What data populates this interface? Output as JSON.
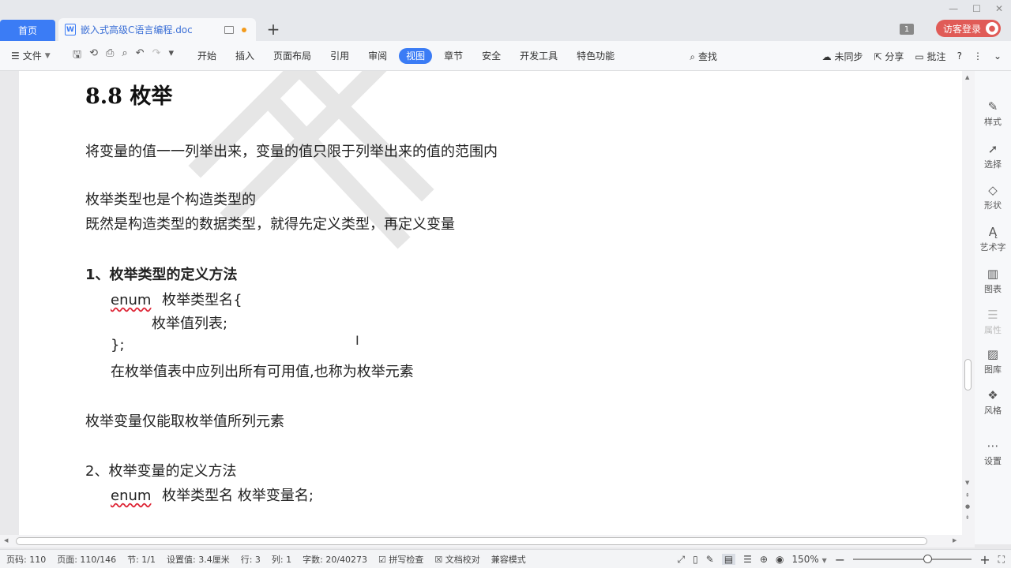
{
  "tabs": {
    "home": "首页",
    "doc_title": "嵌入式高级C语言编程.doc",
    "add": "+"
  },
  "window": {
    "minimize": "—",
    "maximize": "☐",
    "close": "✕",
    "badge": "1",
    "login": "访客登录"
  },
  "ribbon": {
    "file": "文件",
    "menu": [
      {
        "label": "开始",
        "active": false
      },
      {
        "label": "插入",
        "active": false
      },
      {
        "label": "页面布局",
        "active": false
      },
      {
        "label": "引用",
        "active": false
      },
      {
        "label": "审阅",
        "active": false
      },
      {
        "label": "视图",
        "active": true
      },
      {
        "label": "章节",
        "active": false
      },
      {
        "label": "安全",
        "active": false
      },
      {
        "label": "开发工具",
        "active": false
      },
      {
        "label": "特色功能",
        "active": false
      }
    ],
    "search": "查找",
    "sync": "未同步",
    "share": "分享",
    "comment": "批注",
    "help": "?"
  },
  "document": {
    "heading": "8.8  枚举",
    "lines": [
      "将变量的值一一列举出来，变量的值只限于列举出来的值的范围内",
      "枚举类型也是个构造类型的",
      "既然是构造类型的数据类型，就得先定义类型，再定义变量",
      "1、枚举类型的定义方法",
      "enum",
      "枚举类型名{",
      "枚举值列表;",
      "};",
      "在枚举值表中应列出所有可用值,也称为枚举元素",
      "枚举变量仅能取枚举值所列元素",
      "2、枚举变量的定义方法",
      "enum",
      "枚举类型名    枚举变量名;"
    ]
  },
  "sidepanel": [
    {
      "label": "样式",
      "icon": "pen-icon",
      "disabled": false
    },
    {
      "label": "选择",
      "icon": "cursor-icon",
      "disabled": false
    },
    {
      "label": "形状",
      "icon": "shapes-icon",
      "disabled": false
    },
    {
      "label": "艺术字",
      "icon": "art-text-icon",
      "disabled": false
    },
    {
      "label": "图表",
      "icon": "chart-icon",
      "disabled": false
    },
    {
      "label": "属性",
      "icon": "properties-icon",
      "disabled": true
    },
    {
      "label": "图库",
      "icon": "gallery-icon",
      "disabled": false
    },
    {
      "label": "风格",
      "icon": "style-icon",
      "disabled": false
    },
    {
      "label": "设置",
      "icon": "more-icon",
      "disabled": false
    }
  ],
  "status": {
    "page_code": "页码: 110",
    "page": "页面: 110/146",
    "section": "节: 1/1",
    "setting": "设置值: 3.4厘米",
    "row": "行: 3",
    "col": "列: 1",
    "wordcount": "字数: 20/40273",
    "spellcheck": "拼写检查",
    "proof": "文档校对",
    "compat": "兼容模式",
    "zoom": "150%"
  },
  "zoom_level": 0.63
}
